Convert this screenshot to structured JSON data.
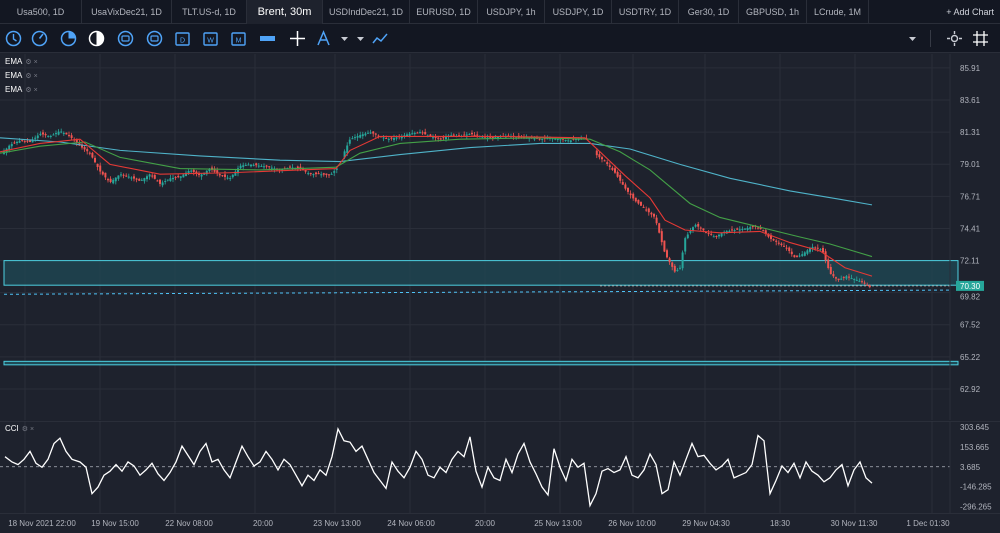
{
  "tabs": [
    {
      "label": "Usa500, 1D",
      "active": false,
      "w": 82
    },
    {
      "label": "UsaVixDec21, 1D",
      "active": false,
      "w": 90
    },
    {
      "label": "TLT.US-d, 1D",
      "active": false,
      "w": 75
    },
    {
      "label": "Brent, 30m",
      "active": true,
      "w": 76
    },
    {
      "label": "USDIndDec21, 1D",
      "active": false,
      "w": 87
    },
    {
      "label": "EURUSD, 1D",
      "active": false,
      "w": 68
    },
    {
      "label": "USDJPY, 1h",
      "active": false,
      "w": 67
    },
    {
      "label": "USDJPY, 1D",
      "active": false,
      "w": 67
    },
    {
      "label": "USDTRY, 1D",
      "active": false,
      "w": 67
    },
    {
      "label": "Ger30, 1D",
      "active": false,
      "w": 60
    },
    {
      "label": "GBPUSD, 1h",
      "active": false,
      "w": 68
    },
    {
      "label": "LCrude, 1M",
      "active": false,
      "w": 62
    }
  ],
  "add_chart_label": "+ Add Chart",
  "toolbar_icons": [
    "clock-icon",
    "speedometer-icon",
    "pie-icon",
    "half-circle-icon",
    "gauge-icon",
    "gauge-2-icon",
    "calendar-d-icon",
    "calendar-w-icon",
    "calendar-m-icon",
    "candle-type-icon",
    "crosshair-icon",
    "text-tool-icon",
    "text-dropdown-icon",
    "marker-dropdown-icon",
    "line-style-icon",
    "line-dropdown-icon",
    "settings-icon",
    "grid-icon"
  ],
  "legend": {
    "ema": [
      "EMA",
      "EMA",
      "EMA"
    ],
    "cci": "CCI"
  },
  "colors": {
    "bg": "#1e222d",
    "bull": "#26a69a",
    "bear": "#ef5350",
    "ema_fast": "#e53935",
    "ema_mid": "#43a047",
    "ema_slow": "#4fb3c9",
    "zone": "#4dd0e1"
  },
  "price_axis": {
    "labels": [
      "85.91",
      "83.61",
      "81.31",
      "79.01",
      "76.71",
      "74.41",
      "72.11",
      "67.52",
      "65.22",
      "62.92"
    ],
    "current_price": "70.30",
    "current_price_secondary": "69.82"
  },
  "cci_axis": {
    "labels": [
      "303.645",
      "153.665",
      "3.685",
      "-146.285",
      "-296.265"
    ]
  },
  "time_axis": {
    "labels": [
      "18 Nov 2021 22:00",
      "19 Nov 15:00",
      "22 Nov 08:00",
      "20:00",
      "23 Nov 13:00",
      "24 Nov 06:00",
      "20:00",
      "25 Nov 13:00",
      "26 Nov 10:00",
      "29 Nov 04:30",
      "18:30",
      "30 Nov 11:30",
      "1 Dec 01:30"
    ]
  },
  "chart_data": {
    "type": "candlestick",
    "symbol": "Brent",
    "timeframe": "30m",
    "y_range": [
      60.7,
      86.9
    ],
    "zones": [
      [
        70.35,
        72.11
      ],
      [
        64.65,
        64.9
      ]
    ],
    "price_path": [
      [
        0,
        79.6
      ],
      [
        10,
        80.4
      ],
      [
        20,
        80.7
      ],
      [
        30,
        80.6
      ],
      [
        40,
        81.2
      ],
      [
        50,
        81.0
      ],
      [
        60,
        81.4
      ],
      [
        70,
        81.0
      ],
      [
        80,
        80.3
      ],
      [
        90,
        79.8
      ],
      [
        100,
        78.5
      ],
      [
        110,
        77.7
      ],
      [
        120,
        78.3
      ],
      [
        130,
        78.1
      ],
      [
        140,
        77.8
      ],
      [
        150,
        78.3
      ],
      [
        160,
        77.6
      ],
      [
        170,
        78.0
      ],
      [
        180,
        78.1
      ],
      [
        190,
        78.6
      ],
      [
        200,
        78.2
      ],
      [
        210,
        78.7
      ],
      [
        220,
        78.2
      ],
      [
        230,
        78.0
      ],
      [
        240,
        78.9
      ],
      [
        250,
        79.0
      ],
      [
        260,
        78.9
      ],
      [
        270,
        78.8
      ],
      [
        280,
        78.6
      ],
      [
        290,
        78.8
      ],
      [
        300,
        78.7
      ],
      [
        310,
        78.3
      ],
      [
        320,
        78.3
      ],
      [
        330,
        78.2
      ],
      [
        338,
        78.8
      ],
      [
        345,
        80.0
      ],
      [
        350,
        80.8
      ],
      [
        360,
        81.1
      ],
      [
        370,
        81.3
      ],
      [
        380,
        81.0
      ],
      [
        390,
        80.8
      ],
      [
        400,
        81.0
      ],
      [
        410,
        81.2
      ],
      [
        420,
        81.3
      ],
      [
        430,
        81.0
      ],
      [
        440,
        80.8
      ],
      [
        450,
        81.1
      ],
      [
        460,
        81.0
      ],
      [
        470,
        81.2
      ],
      [
        480,
        81.0
      ],
      [
        490,
        80.9
      ],
      [
        500,
        81.0
      ],
      [
        510,
        81.0
      ],
      [
        520,
        80.9
      ],
      [
        530,
        80.9
      ],
      [
        540,
        80.8
      ],
      [
        550,
        80.9
      ],
      [
        560,
        80.8
      ],
      [
        570,
        80.7
      ],
      [
        580,
        80.9
      ],
      [
        588,
        80.8
      ],
      [
        596,
        79.7
      ],
      [
        605,
        79.2
      ],
      [
        615,
        78.4
      ],
      [
        625,
        77.3
      ],
      [
        635,
        76.4
      ],
      [
        645,
        75.8
      ],
      [
        655,
        75.2
      ],
      [
        665,
        72.6
      ],
      [
        675,
        71.3
      ],
      [
        680,
        71.6
      ],
      [
        685,
        73.7
      ],
      [
        695,
        74.7
      ],
      [
        705,
        74.2
      ],
      [
        715,
        73.8
      ],
      [
        725,
        74.2
      ],
      [
        735,
        74.3
      ],
      [
        745,
        74.4
      ],
      [
        755,
        74.6
      ],
      [
        762,
        74.3
      ],
      [
        770,
        73.7
      ],
      [
        780,
        73.3
      ],
      [
        788,
        72.9
      ],
      [
        795,
        72.3
      ],
      [
        803,
        72.6
      ],
      [
        812,
        73.1
      ],
      [
        822,
        72.9
      ],
      [
        830,
        71.2
      ],
      [
        838,
        70.7
      ],
      [
        846,
        71.0
      ],
      [
        854,
        70.8
      ],
      [
        862,
        70.6
      ],
      [
        870,
        70.2
      ]
    ],
    "ema_fast": [
      [
        0,
        79.9
      ],
      [
        40,
        80.5
      ],
      [
        80,
        80.8
      ],
      [
        110,
        79.0
      ],
      [
        160,
        78.3
      ],
      [
        230,
        78.4
      ],
      [
        300,
        78.6
      ],
      [
        336,
        78.7
      ],
      [
        350,
        80.0
      ],
      [
        380,
        81.0
      ],
      [
        430,
        81.0
      ],
      [
        500,
        81.0
      ],
      [
        585,
        80.9
      ],
      [
        600,
        79.9
      ],
      [
        625,
        78.2
      ],
      [
        650,
        76.6
      ],
      [
        665,
        75.0
      ],
      [
        685,
        74.3
      ],
      [
        720,
        74.1
      ],
      [
        760,
        74.2
      ],
      [
        790,
        73.4
      ],
      [
        820,
        72.8
      ],
      [
        845,
        71.6
      ],
      [
        872,
        71.0
      ]
    ],
    "ema_mid": [
      [
        0,
        79.8
      ],
      [
        40,
        80.3
      ],
      [
        85,
        80.6
      ],
      [
        120,
        79.5
      ],
      [
        180,
        78.7
      ],
      [
        260,
        78.6
      ],
      [
        336,
        78.8
      ],
      [
        360,
        79.8
      ],
      [
        400,
        80.5
      ],
      [
        460,
        80.8
      ],
      [
        540,
        80.9
      ],
      [
        590,
        80.8
      ],
      [
        620,
        79.9
      ],
      [
        650,
        78.6
      ],
      [
        690,
        76.2
      ],
      [
        720,
        75.2
      ],
      [
        760,
        74.5
      ],
      [
        800,
        73.8
      ],
      [
        830,
        73.3
      ],
      [
        872,
        72.4
      ]
    ],
    "ema_slow": [
      [
        0,
        80.9
      ],
      [
        60,
        80.6
      ],
      [
        120,
        80.0
      ],
      [
        200,
        79.6
      ],
      [
        280,
        79.3
      ],
      [
        340,
        79.2
      ],
      [
        400,
        79.7
      ],
      [
        470,
        80.2
      ],
      [
        540,
        80.5
      ],
      [
        590,
        80.5
      ],
      [
        630,
        80.1
      ],
      [
        680,
        79.0
      ],
      [
        730,
        78.0
      ],
      [
        790,
        77.1
      ],
      [
        840,
        76.5
      ],
      [
        872,
        76.1
      ]
    ]
  },
  "cci_data": {
    "y_range": [
      -346.25,
      350
    ],
    "series": [
      [
        5,
        80
      ],
      [
        12,
        40
      ],
      [
        18,
        20
      ],
      [
        24,
        60
      ],
      [
        30,
        120
      ],
      [
        36,
        30
      ],
      [
        42,
        0
      ],
      [
        48,
        60
      ],
      [
        54,
        180
      ],
      [
        60,
        220
      ],
      [
        66,
        120
      ],
      [
        72,
        60
      ],
      [
        80,
        40
      ],
      [
        86,
        0
      ],
      [
        92,
        -200
      ],
      [
        98,
        -150
      ],
      [
        104,
        -60
      ],
      [
        110,
        -30
      ],
      [
        116,
        20
      ],
      [
        122,
        -30
      ],
      [
        128,
        40
      ],
      [
        134,
        10
      ],
      [
        140,
        -60
      ],
      [
        146,
        -20
      ],
      [
        152,
        30
      ],
      [
        158,
        -50
      ],
      [
        164,
        -100
      ],
      [
        170,
        -40
      ],
      [
        176,
        40
      ],
      [
        182,
        160
      ],
      [
        188,
        90
      ],
      [
        194,
        20
      ],
      [
        200,
        120
      ],
      [
        206,
        180
      ],
      [
        212,
        40
      ],
      [
        218,
        60
      ],
      [
        224,
        -20
      ],
      [
        230,
        -80
      ],
      [
        236,
        40
      ],
      [
        242,
        160
      ],
      [
        248,
        80
      ],
      [
        254,
        10
      ],
      [
        260,
        40
      ],
      [
        266,
        120
      ],
      [
        272,
        60
      ],
      [
        278,
        -20
      ],
      [
        284,
        60
      ],
      [
        290,
        20
      ],
      [
        296,
        -60
      ],
      [
        302,
        -140
      ],
      [
        308,
        -60
      ],
      [
        314,
        -100
      ],
      [
        320,
        -20
      ],
      [
        326,
        -60
      ],
      [
        332,
        80
      ],
      [
        338,
        290
      ],
      [
        344,
        200
      ],
      [
        350,
        190
      ],
      [
        356,
        120
      ],
      [
        362,
        160
      ],
      [
        368,
        60
      ],
      [
        374,
        -40
      ],
      [
        380,
        -100
      ],
      [
        386,
        -160
      ],
      [
        392,
        40
      ],
      [
        398,
        -30
      ],
      [
        404,
        -80
      ],
      [
        410,
        0
      ],
      [
        416,
        120
      ],
      [
        422,
        60
      ],
      [
        428,
        -60
      ],
      [
        434,
        -80
      ],
      [
        440,
        0
      ],
      [
        446,
        -40
      ],
      [
        452,
        60
      ],
      [
        458,
        120
      ],
      [
        464,
        80
      ],
      [
        470,
        230
      ],
      [
        476,
        -30
      ],
      [
        482,
        -150
      ],
      [
        488,
        0
      ],
      [
        494,
        -80
      ],
      [
        500,
        -100
      ],
      [
        506,
        60
      ],
      [
        512,
        -40
      ],
      [
        518,
        100
      ],
      [
        524,
        180
      ],
      [
        530,
        40
      ],
      [
        536,
        -50
      ],
      [
        542,
        -150
      ],
      [
        548,
        -210
      ],
      [
        554,
        140
      ],
      [
        560,
        0
      ],
      [
        566,
        -100
      ],
      [
        572,
        60
      ],
      [
        578,
        0
      ],
      [
        584,
        30
      ],
      [
        590,
        -290
      ],
      [
        596,
        -200
      ],
      [
        602,
        -30
      ],
      [
        608,
        -10
      ],
      [
        614,
        -40
      ],
      [
        620,
        -20
      ],
      [
        626,
        80
      ],
      [
        632,
        -60
      ],
      [
        638,
        -80
      ],
      [
        644,
        -20
      ],
      [
        650,
        100
      ],
      [
        656,
        20
      ],
      [
        662,
        -200
      ],
      [
        668,
        -170
      ],
      [
        674,
        40
      ],
      [
        680,
        -60
      ],
      [
        686,
        60
      ],
      [
        692,
        180
      ],
      [
        698,
        80
      ],
      [
        704,
        90
      ],
      [
        710,
        30
      ],
      [
        716,
        -20
      ],
      [
        722,
        10
      ],
      [
        728,
        60
      ],
      [
        734,
        -80
      ],
      [
        740,
        -60
      ],
      [
        746,
        -40
      ],
      [
        752,
        20
      ],
      [
        758,
        240
      ],
      [
        764,
        200
      ],
      [
        770,
        -200
      ],
      [
        776,
        -100
      ],
      [
        782,
        10
      ],
      [
        788,
        -40
      ],
      [
        794,
        30
      ],
      [
        800,
        -80
      ],
      [
        806,
        40
      ],
      [
        812,
        -30
      ],
      [
        818,
        -60
      ],
      [
        824,
        -110
      ],
      [
        830,
        -80
      ],
      [
        836,
        -20
      ],
      [
        842,
        20
      ],
      [
        848,
        -140
      ],
      [
        854,
        -20
      ],
      [
        860,
        40
      ],
      [
        866,
        -80
      ],
      [
        872,
        -120
      ]
    ]
  }
}
